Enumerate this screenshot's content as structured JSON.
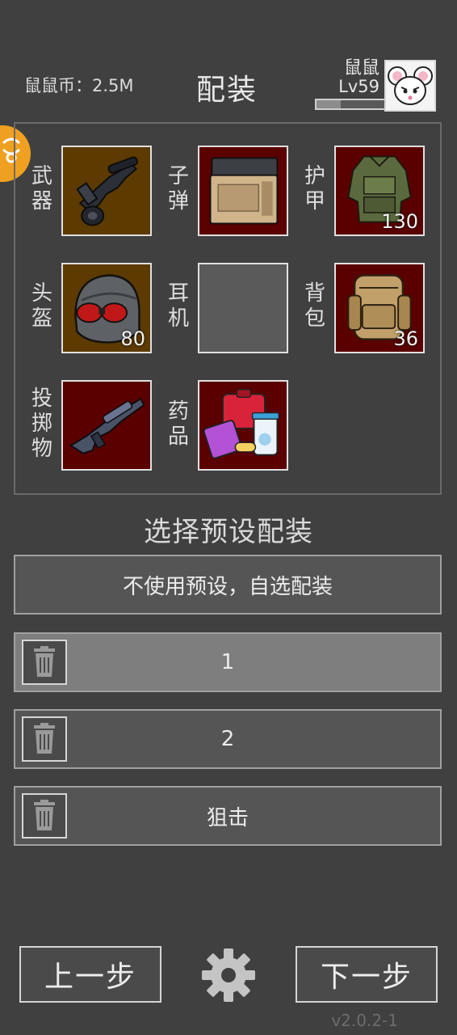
{
  "header": {
    "coins_label": "鼠鼠币：2.5M",
    "title": "配装",
    "player_name": "鼠鼠",
    "player_level": "Lv59",
    "xp_fraction": 0.35,
    "avatar_icon": "white-mouse-avatar"
  },
  "side_icon": "orange-emblem-icon",
  "equipment": {
    "weapon": {
      "label": "武器",
      "icon": "rifle-with-scope-icon",
      "count": ""
    },
    "ammo": {
      "label": "子弹",
      "icon": "ammo-box-icon",
      "count": ""
    },
    "armor": {
      "label": "护甲",
      "icon": "body-armor-icon",
      "count": "130"
    },
    "helmet": {
      "label": "头盔",
      "icon": "helmet-with-goggles-icon",
      "count": "80"
    },
    "headset": {
      "label": "耳机",
      "icon": "",
      "count": ""
    },
    "backpack": {
      "label": "背包",
      "icon": "backpack-icon",
      "count": "36"
    },
    "throwable": {
      "label": "投掷物",
      "icon": "grenade-launcher-icon",
      "count": ""
    },
    "medicine": {
      "label": "药品",
      "icon": "medkit-and-pills-icon",
      "count": ""
    }
  },
  "presets": {
    "title": "选择预设配装",
    "custom_option": "不使用预设，自选配装",
    "items": [
      {
        "name": "1",
        "selected": true
      },
      {
        "name": "2",
        "selected": false
      },
      {
        "name": "狙击",
        "selected": false
      }
    ]
  },
  "footer": {
    "prev_label": "上一步",
    "next_label": "下一步",
    "settings_icon": "gear-icon",
    "version": "v2.0.2-1"
  },
  "colors": {
    "background": "#404040",
    "slot_red": "#5a0000",
    "slot_brown": "#5c3a00",
    "side_icon": "#f0a020"
  }
}
